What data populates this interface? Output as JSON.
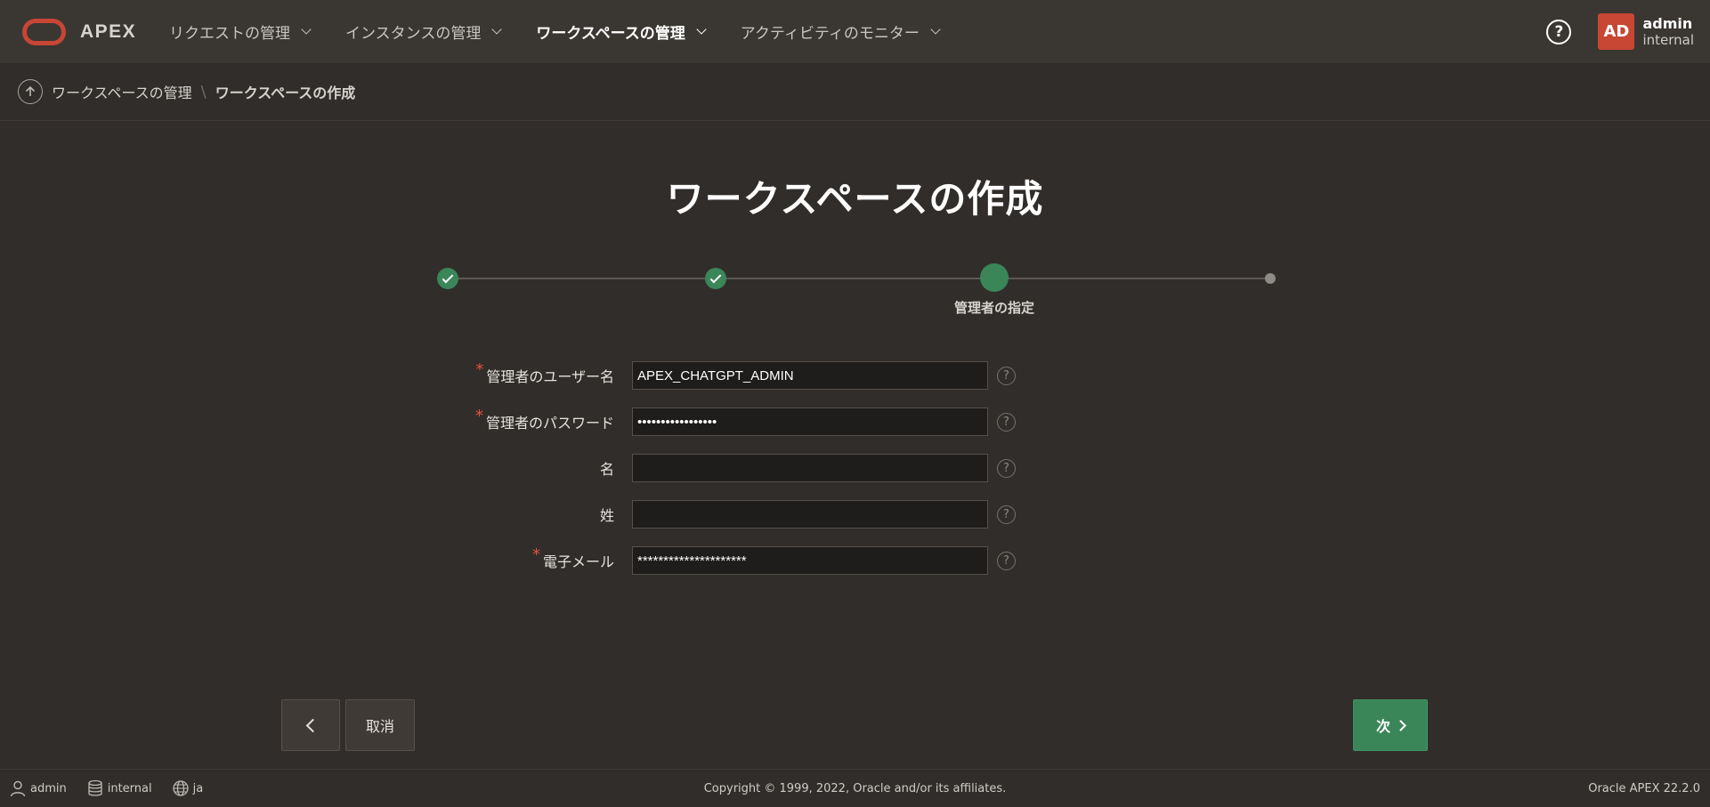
{
  "header": {
    "brand": "APEX",
    "nav": [
      {
        "label": "リクエストの管理",
        "active": false
      },
      {
        "label": "インスタンスの管理",
        "active": false
      },
      {
        "label": "ワークスペースの管理",
        "active": true
      },
      {
        "label": "アクティビティのモニター",
        "active": false
      }
    ],
    "help_glyph": "?",
    "avatar_initials": "AD",
    "user_name": "admin",
    "workspace_name": "internal"
  },
  "breadcrumb": {
    "parent": "ワークスペースの管理",
    "current": "ワークスペースの作成"
  },
  "page_title": "ワークスペースの作成",
  "wizard": {
    "steps_total": 4,
    "current_step": 3,
    "current_label": "管理者の指定"
  },
  "form": {
    "fields": [
      {
        "label": "管理者のユーザー名",
        "required": true,
        "value": "APEX_CHATGPT_ADMIN"
      },
      {
        "label": "管理者のパスワード",
        "required": true,
        "value": "•••••••••••••••••"
      },
      {
        "label": "名",
        "required": false,
        "value": ""
      },
      {
        "label": "姓",
        "required": false,
        "value": ""
      },
      {
        "label": "電子メール",
        "required": true,
        "value": "*********************"
      }
    ],
    "required_mark": "*",
    "help_glyph": "?"
  },
  "buttons": {
    "cancel": "取消",
    "next": "次"
  },
  "footer": {
    "user": "admin",
    "workspace": "internal",
    "language": "ja",
    "copyright": "Copyright © 1999, 2022, Oracle and/or its affiliates.",
    "version": "Oracle APEX 22.2.0"
  },
  "colors": {
    "accent_green": "#3a8659",
    "brand_red": "#c74634",
    "background": "#312d2a",
    "header_bg": "#3a3632"
  }
}
